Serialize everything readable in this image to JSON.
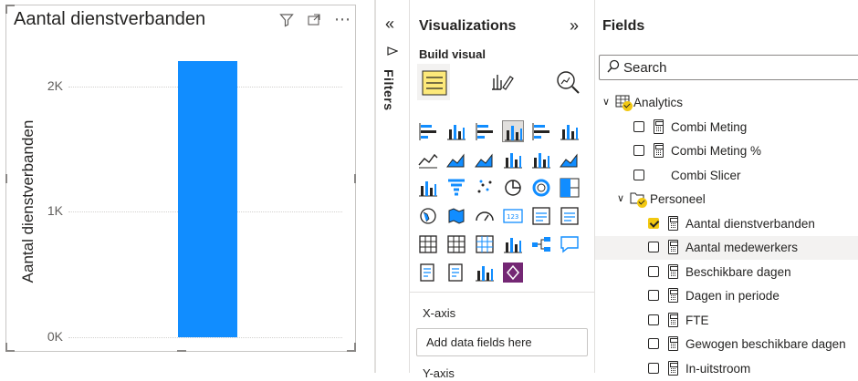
{
  "canvas": {
    "visual_title": "Aantal dienstverbanden",
    "icons": [
      "filter-icon",
      "focus-mode-icon",
      "more-options-icon"
    ],
    "more_glyph": "⋯",
    "chart_data": {
      "type": "bar",
      "title": "Aantal dienstverbanden",
      "xlabel": "",
      "ylabel": "Aantal dienstverbanden",
      "categories": [
        ""
      ],
      "values": [
        2200
      ],
      "ylim": [
        0,
        2500
      ],
      "yticks": [
        0,
        1000,
        2000
      ],
      "ytick_labels": [
        "0K",
        "1K",
        "2K"
      ],
      "grid": true,
      "bar_color": "#118dff"
    }
  },
  "filters": {
    "collapse_glyph": "«",
    "label": "Filters"
  },
  "visualizations": {
    "title": "Visualizations",
    "expand_glyph": "»",
    "build_visual_label": "Build visual",
    "x_axis_label": "X-axis",
    "x_axis_well_placeholder": "Add data fields here",
    "y_axis_label": "Y-axis",
    "accent_color": "#f2c811"
  },
  "fields": {
    "title": "Fields",
    "search_placeholder": "Search",
    "tables": [
      {
        "name": "Analytics",
        "items": [
          {
            "label": "Combi Meting",
            "checked": false,
            "icon": "calculator-icon"
          },
          {
            "label": "Combi Meting %",
            "checked": false,
            "icon": "calculator-icon"
          },
          {
            "label": "Combi Slicer",
            "checked": false,
            "icon": ""
          }
        ]
      },
      {
        "name": "Personeel",
        "items": [
          {
            "label": "Aantal dienstverbanden",
            "checked": true,
            "icon": "calculator-icon"
          },
          {
            "label": "Aantal medewerkers",
            "checked": false,
            "icon": "calculator-icon"
          },
          {
            "label": "Beschikbare dagen",
            "checked": false,
            "icon": "calculator-icon"
          },
          {
            "label": "Dagen in periode",
            "checked": false,
            "icon": "calculator-icon"
          },
          {
            "label": "FTE",
            "checked": false,
            "icon": "calculator-icon"
          },
          {
            "label": "Gewogen beschikbare dagen",
            "checked": false,
            "icon": "calculator-icon"
          },
          {
            "label": "In-uitstroom",
            "checked": false,
            "icon": "calculator-icon"
          }
        ]
      }
    ]
  }
}
